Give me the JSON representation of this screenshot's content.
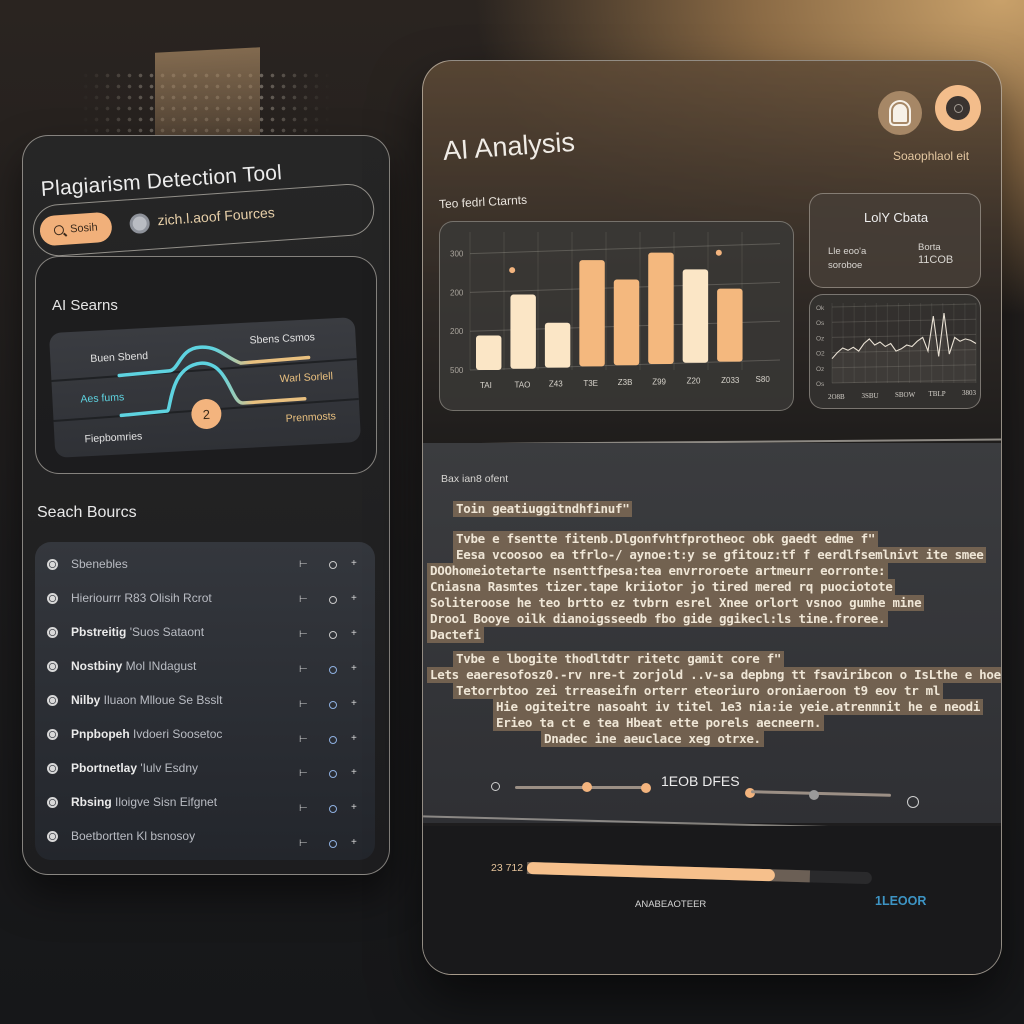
{
  "left_panel": {
    "title": "Plagiarism Detection Tool",
    "search_button_label": "Sosih",
    "source_toggle_label": "zich.l.aoof Fources",
    "ai_card": {
      "title": "AI Searns",
      "flow_labels": {
        "top_left": "Buen Sbend",
        "mid_left": "Aes fums",
        "bottom_left": "Fiepbomries",
        "top_right": "Sbens Csmos",
        "mid_right": "Warl Sorlell",
        "bottom_right": "Prenmosts"
      },
      "badge": "2",
      "colors": {
        "cyan": "#5ed3e0",
        "gold": "#e9c07f"
      }
    },
    "sources_title": "Seach Bourcs",
    "sources": [
      {
        "strong": "",
        "label": "Sbenebles"
      },
      {
        "strong": "",
        "label": "Hieriourrr R83 Olisih Rcrot"
      },
      {
        "strong": "Pbstreitig",
        "label": "'Suos Sataont"
      },
      {
        "strong": "Nostbiny",
        "label": "Mol INdagust"
      },
      {
        "strong": "Nilby",
        "label": "Iluaon Mlloue Se Bsslt"
      },
      {
        "strong": "Pnpbopeh",
        "label": "Ivdoeri Soosetoc"
      },
      {
        "strong": "Pbortnetlay",
        "label": "'Iulv Esdny"
      },
      {
        "strong": "Rbsing",
        "label": "Iloigve Sisn Eifgnet"
      },
      {
        "strong": "",
        "label": "Boetbortten Kl bsnosoy"
      }
    ],
    "source_action_icons": [
      "pin-icon",
      "circle-icon",
      "plus-icon"
    ]
  },
  "right_panel": {
    "title": "AI Analysis",
    "status": "Soaophlaol eit",
    "charts_label": "Teo fedrl Ctarnts",
    "summary_card": {
      "title": "LolY Cbata",
      "left_line1": "Lle eoo'a",
      "left_line2": "soroboe",
      "right_label": "Borta",
      "right_value": "11COB"
    },
    "text_section": {
      "label": "Bax ian8 ofent",
      "paragraph1": [
        "Toin geatiuggitndhfinuf\"",
        "Tvbe e fsentte fitenb.Dlgonfvhtfprotheoc obk gaedt edme f\"",
        "Eesa vcoosoo ea tfrlo-/ aynoe:t:y se gfitouz:tf f eerdlfsemlnivt ite smee",
        "DOOhomeiotetarte nsenttfpesa:tea envrroroete artmeurr eorronte:",
        "Cniasna Rasmtes tizer.tape kriiotor jo tired mered rq puociotote",
        "Soliteroose he teo brtto ez tvbrn esrel Xnee orlort vsnoo gumhe mine",
        "Droo1 Booye oilk dianoigsseedb fbo gide ggikecl:ls tine.froree.",
        "Dactefi"
      ],
      "paragraph2": [
        "Tvbe e lbogite thodltdtr ritetc gamit core f\"",
        "Lets eaeresofosz0.-rv nre-t zorjold ..v-sa depbng tt fsaviribcon o IsLthe e hoe",
        "Tetorrbtoo zei trreaseifn orterr eteoriuro oroniaeroon t9 eov tr ml",
        "Hie ogiteitre nasoaht iv titel 1e3 nia:ie yeie.atrenmnit he e neodi",
        "Erieo ta ct e tea Hbeat ette porels aecneern.",
        "Dnadec ine aeuclace xeg otrxe."
      ],
      "slider_label": "1EOB DFES",
      "slider_left_value": 0.55,
      "slider_right_value": 0.45
    },
    "progress": {
      "value_label": "23 712",
      "fill_fraction": 0.72,
      "buffer_fraction": 0.82,
      "caption": "ANABEAOTEER",
      "max_label": "1LEOOR"
    },
    "bar_chart": {
      "type": "bar",
      "y_ticks": [
        "300",
        "200",
        "200",
        "500"
      ],
      "categories": [
        "TAI",
        "TAO",
        "Z43",
        "T3E",
        "Z3B",
        "Z99",
        "Z20",
        "Z033",
        "S80"
      ],
      "values": [
        0.27,
        0.58,
        0.35,
        0.83,
        0.67,
        0.87,
        0.73,
        0.57,
        0
      ],
      "bar_colors": [
        "#fbe6c6",
        "#fbe6c6",
        "#fbe6c6",
        "#f4b87e",
        "#f4b87e",
        "#f4b87e",
        "#fbe6c6",
        "#f4b87e"
      ],
      "markers": [
        {
          "after_index": 0,
          "y": 0.78
        },
        {
          "after_index": 6,
          "y": 0.86
        }
      ]
    },
    "line_chart": {
      "type": "line",
      "y_ticks": [
        "Ok",
        "Os",
        "Oz",
        "O2",
        "Oz",
        "Os"
      ],
      "x_labels": [
        "2O8B",
        "3SBU",
        "SBOW",
        "TBLP",
        "3803"
      ],
      "values": [
        0.32,
        0.4,
        0.46,
        0.43,
        0.47,
        0.42,
        0.52,
        0.58,
        0.5,
        0.54,
        0.48,
        0.52,
        0.42,
        0.45,
        0.5,
        0.48,
        0.55,
        0.6,
        0.42,
        0.88,
        0.35,
        0.92,
        0.38,
        0.6,
        0.55,
        0.58,
        0.56,
        0.52
      ]
    }
  }
}
